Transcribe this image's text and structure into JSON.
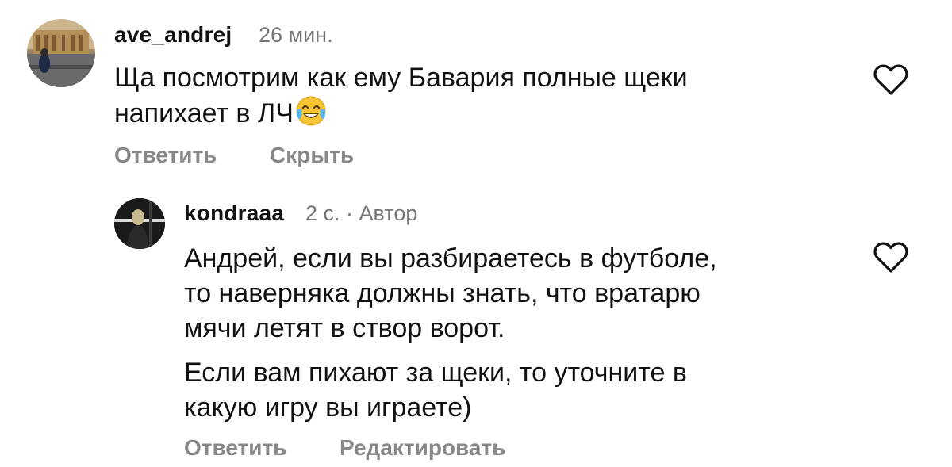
{
  "comments": [
    {
      "username": "ave_andrej",
      "time": "26 мин.",
      "text_line1": "Ща посмотрим как ему Бавария полные щеки",
      "text_line2": "напихает в ЛЧ",
      "emoji": "😂",
      "actions": {
        "reply": "Ответить",
        "hide": "Скрыть"
      }
    },
    {
      "username": "kondraaa",
      "time": "2 с. · Автор",
      "paragraph1": [
        "Андрей, если вы разбираетесь в футболе,",
        "то наверняка должны знать, что вратарю",
        "мячи летят в створ ворот."
      ],
      "paragraph2": [
        "Если вам пихают за щеки, то уточните в",
        "какую игру вы играете)"
      ],
      "actions": {
        "reply": "Ответить",
        "edit": "Редактировать"
      }
    }
  ],
  "icons": {
    "like": "heart-outline-icon",
    "emoji": "face-with-tears-of-joy-icon"
  },
  "colors": {
    "text": "#111111",
    "secondary": "#767676",
    "action": "#888888",
    "heart_stroke": "#111111"
  }
}
